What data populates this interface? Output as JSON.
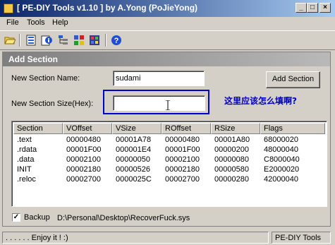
{
  "window": {
    "title": "[ PE-DIY Tools v1.10 ] by A.Yong (PoJieYong)"
  },
  "menu": [
    "File",
    "Tools",
    "Help"
  ],
  "toolbar": {
    "icons": [
      "open-folder-icon",
      "sections-icon",
      "info-icon",
      "tree-icon",
      "properties-icon",
      "import-icon",
      "help-icon"
    ]
  },
  "panel": {
    "title": "Add Section",
    "name_label": "New Section Name:",
    "name_value": "sudami",
    "size_label": "New Section Size(Hex):",
    "size_value": "",
    "add_button": "Add Section",
    "annotation": "这里应该怎么填啊?"
  },
  "sections": {
    "columns": [
      "Section",
      "VOffset",
      "VSize",
      "ROffset",
      "RSize",
      "Flags"
    ],
    "rows": [
      [
        ".text",
        "00000480",
        "00001A78",
        "00000480",
        "00001A80",
        "68000020"
      ],
      [
        ".rdata",
        "00001F00",
        "000001E4",
        "00001F00",
        "00000200",
        "48000040"
      ],
      [
        ".data",
        "00002100",
        "00000050",
        "00002100",
        "00000080",
        "C8000040"
      ],
      [
        "INIT",
        "00002180",
        "00000526",
        "00002180",
        "00000580",
        "E2000020"
      ],
      [
        ".reloc",
        "00002700",
        "0000025C",
        "00002700",
        "00000280",
        "42000040"
      ]
    ]
  },
  "backup": {
    "label": "Backup",
    "checked": true,
    "path": "D:\\Personal\\Desktop\\RecoverFuck.sys"
  },
  "status": {
    "left": ". . . . . . Enjoy it ! :)",
    "right": "PE-DIY Tools"
  },
  "colors": {
    "title_bar": "#0a246a",
    "annotation": "#0000c0",
    "highlight_border": "#0000d0"
  }
}
